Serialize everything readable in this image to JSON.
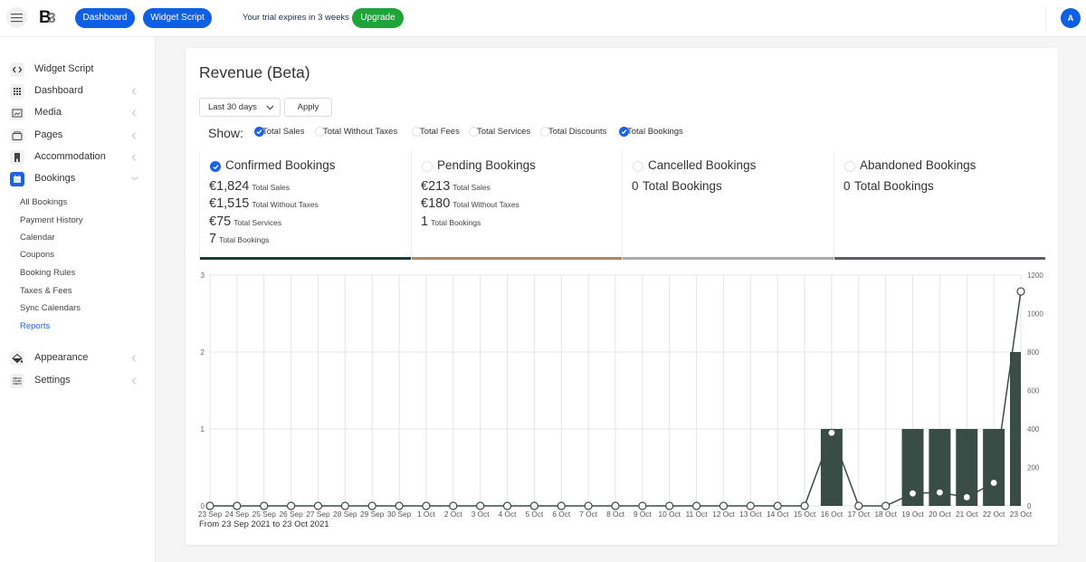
{
  "topbar": {
    "menu_icon": "hamburger-icon",
    "logo": {
      "letter": "B",
      "digit": "3"
    },
    "buttons": [
      {
        "label": "Dashboard"
      },
      {
        "label": "Widget Script"
      }
    ],
    "trial_text": "Your trial expires in 3 weeks",
    "upgrade_label": "Upgrade",
    "avatar_initial": "A"
  },
  "sidebar": {
    "items": [
      {
        "label": "Widget Script",
        "icon": "code-icon"
      },
      {
        "label": "Dashboard",
        "icon": "grid-icon",
        "chevron": "chevron-left-icon"
      },
      {
        "label": "Media",
        "icon": "image-icon",
        "chevron": "chevron-left-icon"
      },
      {
        "label": "Pages",
        "icon": "pages-icon",
        "chevron": "chevron-left-icon"
      },
      {
        "label": "Accommodation",
        "icon": "building-icon",
        "chevron": "chevron-left-icon"
      },
      {
        "label": "Bookings",
        "icon": "calendar-icon",
        "chevron": "chevron-down-icon",
        "expanded": true
      }
    ],
    "bookings_sub": [
      {
        "label": "All Bookings"
      },
      {
        "label": "Payment History"
      },
      {
        "label": "Calendar"
      },
      {
        "label": "Coupons"
      },
      {
        "label": "Booking Rules"
      },
      {
        "label": "Taxes & Fees"
      },
      {
        "label": "Sync Calendars"
      },
      {
        "label": "Reports",
        "active": true
      }
    ],
    "lower_items": [
      {
        "label": "Appearance",
        "icon": "paint-bucket-icon",
        "chevron": "chevron-left-icon"
      },
      {
        "label": "Settings",
        "icon": "sliders-icon",
        "chevron": "chevron-left-icon"
      }
    ]
  },
  "page": {
    "title": "Revenue (Beta)",
    "range_select": "Last 30 days",
    "apply_label": "Apply",
    "show_label": "Show:",
    "filters": [
      {
        "label": "Total Sales",
        "checked": true
      },
      {
        "label": "Total Without Taxes",
        "checked": false
      },
      {
        "label": "Total Fees",
        "checked": false
      },
      {
        "label": "Total Services",
        "checked": false
      },
      {
        "label": "Total Discounts",
        "checked": false
      },
      {
        "label": "Total Bookings",
        "checked": true
      }
    ],
    "range_note": "From 23 Sep 2021 to 23 Oct 2021"
  },
  "stats": [
    {
      "title": "Confirmed Bookings",
      "checked": true,
      "color": "#1d3b33",
      "rows": [
        {
          "value": "€1,824",
          "label": "Total Sales"
        },
        {
          "value": "€1,515",
          "label": "Total Without Taxes"
        },
        {
          "value": "€75",
          "label": "Total Services"
        },
        {
          "value": "7",
          "label": "Total Bookings"
        }
      ]
    },
    {
      "title": "Pending Bookings",
      "checked": false,
      "color": "#a88a6a",
      "rows": [
        {
          "value": "€213",
          "label": "Total Sales"
        },
        {
          "value": "€180",
          "label": "Total Without Taxes"
        },
        {
          "value": "1",
          "label": "Total Bookings"
        }
      ]
    },
    {
      "title": "Cancelled Bookings",
      "checked": false,
      "color": "#aaaaaa",
      "rows": [
        {
          "value": "0",
          "label": "Total Bookings"
        }
      ]
    },
    {
      "title": "Abandoned Bookings",
      "checked": false,
      "color": "#5f5f66",
      "rows": [
        {
          "value": "0",
          "label": "Total Bookings"
        }
      ]
    }
  ],
  "colors": {
    "primary": "#0d5fe3",
    "upgrade": "#1fa43a",
    "active_link": "#1a66e0"
  },
  "chart_data": {
    "type": "bar",
    "title": "",
    "xlabel": "",
    "ylabel": "",
    "categories": [
      "23 Sep",
      "24 Sep",
      "25 Sep",
      "26 Sep",
      "27 Sep",
      "28 Sep",
      "29 Sep",
      "30 Sep",
      "1 Oct",
      "2 Oct",
      "3 Oct",
      "4 Oct",
      "5 Oct",
      "6 Oct",
      "7 Oct",
      "8 Oct",
      "9 Oct",
      "10 Oct",
      "11 Oct",
      "12 Oct",
      "13 Oct",
      "14 Oct",
      "15 Oct",
      "16 Oct",
      "17 Oct",
      "18 Oct",
      "19 Oct",
      "20 Oct",
      "21 Oct",
      "22 Oct",
      "23 Oct"
    ],
    "series": [
      {
        "name": "Total Bookings",
        "type": "bar",
        "axis": "left",
        "color": "#3a4c46",
        "values": [
          0,
          0,
          0,
          0,
          0,
          0,
          0,
          0,
          0,
          0,
          0,
          0,
          0,
          0,
          0,
          0,
          0,
          0,
          0,
          0,
          0,
          0,
          0,
          1,
          0,
          0,
          1,
          1,
          1,
          1,
          2
        ]
      },
      {
        "name": "Total Sales",
        "type": "line",
        "axis": "right",
        "color": "#3d4a46",
        "values": [
          0,
          0,
          0,
          0,
          0,
          0,
          0,
          0,
          0,
          0,
          0,
          0,
          0,
          0,
          0,
          0,
          0,
          0,
          0,
          0,
          0,
          0,
          0,
          380,
          0,
          0,
          65,
          70,
          45,
          120,
          1115
        ]
      }
    ],
    "y_left": {
      "min": 0,
      "max": 3,
      "ticks": [
        0,
        1,
        2,
        3
      ]
    },
    "y_right": {
      "min": 0,
      "max": 1200,
      "ticks": [
        0,
        200,
        400,
        600,
        800,
        1000,
        1200
      ]
    },
    "grid": true,
    "legend": "none"
  }
}
